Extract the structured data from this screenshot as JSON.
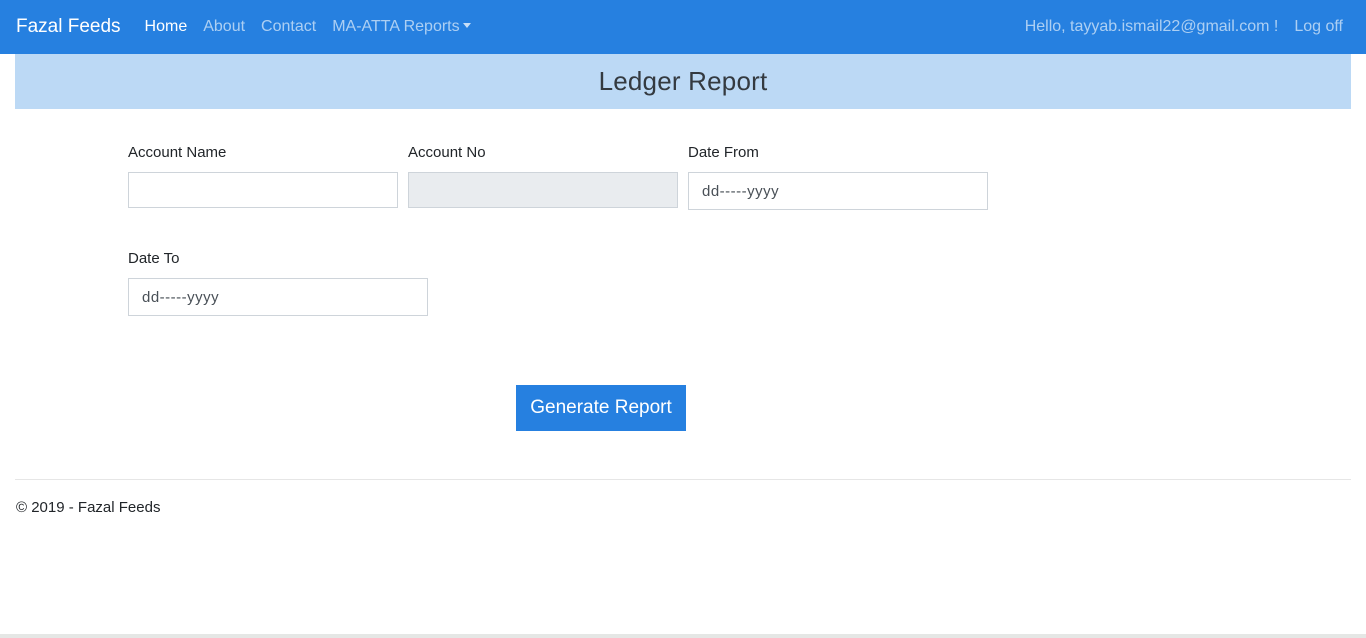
{
  "navbar": {
    "brand": "Fazal Feeds",
    "links": [
      "Home",
      "About",
      "Contact",
      "MA-ATTA Reports"
    ],
    "greeting": "Hello, tayyab.ismail22@gmail.com !",
    "logoff": "Log off",
    "color": "#2680e0"
  },
  "page": {
    "title": "Ledger Report",
    "banner_color": "#bcd9f5"
  },
  "form": {
    "account_name": {
      "label": "Account Name",
      "value": ""
    },
    "account_no": {
      "label": "Account No",
      "value": ""
    },
    "date_from": {
      "label": "Date From",
      "placeholder": "dd-----yyyy"
    },
    "date_to": {
      "label": "Date To",
      "placeholder": "dd-----yyyy"
    },
    "submit_label": "Generate Report"
  },
  "footer": {
    "text": "© 2019 - Fazal Feeds"
  }
}
